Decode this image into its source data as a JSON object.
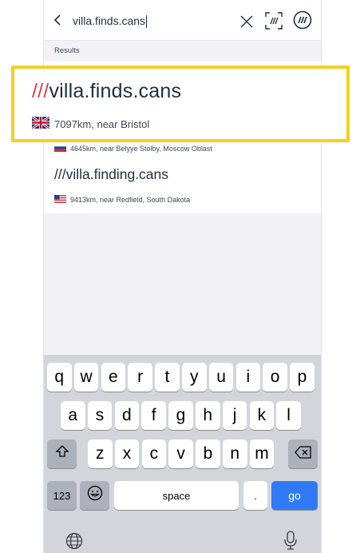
{
  "search": {
    "query": "villa.finds.cans"
  },
  "results_label": "Results",
  "highlighted": {
    "slashes": "///",
    "words": "villa.finds.cans",
    "distance": "7097km, near Bristol",
    "flag": "UK"
  },
  "results": [
    {
      "distance": "4645km, near Belyye Stolby, Moscow Oblast",
      "flag": "Russia"
    },
    {
      "slashes": "///",
      "words": "villa.finding.cans",
      "distance": "9413km, near Redfield, South Dakota",
      "flag": "USA"
    }
  ],
  "keyboard": {
    "row1": [
      "q",
      "w",
      "e",
      "r",
      "t",
      "y",
      "u",
      "i",
      "o",
      "p"
    ],
    "row2": [
      "a",
      "s",
      "d",
      "f",
      "g",
      "h",
      "j",
      "k",
      "l"
    ],
    "row3": [
      "z",
      "x",
      "c",
      "v",
      "b",
      "n",
      "m"
    ],
    "numbers_label": "123",
    "space_label": "space",
    "period_label": ".",
    "go_label": "go"
  },
  "colors": {
    "highlight_border": "#f5cf1f",
    "slash": "#e03a3e",
    "go": "#2f7bf6"
  }
}
